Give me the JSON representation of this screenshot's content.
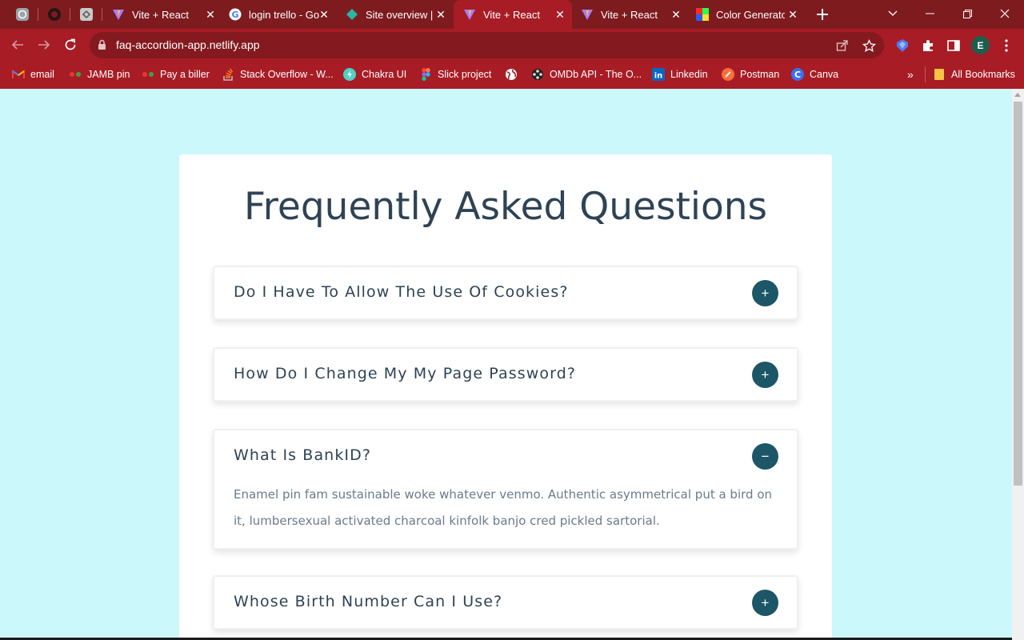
{
  "browser": {
    "tabs": [
      {
        "title": "Vite + React"
      },
      {
        "title": "login trello - Go"
      },
      {
        "title": "Site overview |"
      },
      {
        "title": "Vite + React",
        "active": true
      },
      {
        "title": "Vite + React"
      },
      {
        "title": "Color Generator"
      }
    ],
    "url": "faq-accordion-app.netlify.app",
    "profile_initial": "E",
    "bookmarks": [
      {
        "label": "email",
        "icon": "gmail-icon"
      },
      {
        "label": "JAMB pin",
        "icon": "dots-icon"
      },
      {
        "label": "Pay a biller",
        "icon": "dots-icon"
      },
      {
        "label": "Stack Overflow - W...",
        "icon": "stackoverflow-icon"
      },
      {
        "label": "Chakra UI",
        "icon": "chakra-icon"
      },
      {
        "label": "Slick project",
        "icon": "figma-icon"
      },
      {
        "label": "",
        "icon": "globe-icon"
      },
      {
        "label": "OMDb API - The O...",
        "icon": "omdb-icon"
      },
      {
        "label": "Linkedin",
        "icon": "linkedin-icon"
      },
      {
        "label": "Postman",
        "icon": "postman-icon"
      },
      {
        "label": "Canva",
        "icon": "canva-icon"
      }
    ],
    "more_bookmarks": "»",
    "all_bookmarks": "All Bookmarks"
  },
  "page": {
    "title": "Frequently Asked Questions",
    "questions": [
      {
        "question": "Do I Have To Allow The Use Of Cookies?",
        "expanded": false,
        "toggle": "+"
      },
      {
        "question": "How Do I Change My My Page Password?",
        "expanded": false,
        "toggle": "+"
      },
      {
        "question": "What Is BankID?",
        "expanded": true,
        "toggle": "−",
        "answer": "Enamel pin fam sustainable woke whatever venmo. Authentic asymmetrical put a bird on it, lumbersexual activated charcoal kinfolk banjo cred pickled sartorial."
      },
      {
        "question": "Whose Birth Number Can I Use?",
        "expanded": false,
        "toggle": "+"
      }
    ]
  },
  "colors": {
    "page_background": "#cbf8fb",
    "card_background": "#ffffff",
    "heading_text": "#2e4355",
    "toggle_button": "#1c5667",
    "answer_text": "#6a7b8c",
    "browser_frame": "#a81c25"
  }
}
